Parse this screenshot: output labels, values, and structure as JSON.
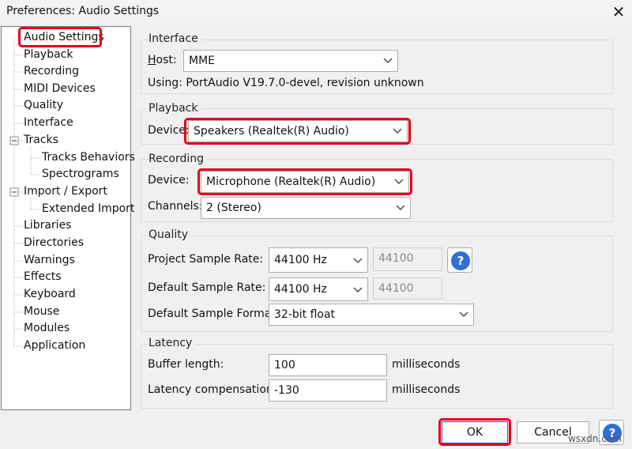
{
  "window": {
    "title": "Preferences: Audio Settings",
    "close_glyph": "✕"
  },
  "sidebar": {
    "items": [
      {
        "label": "Audio Settings"
      },
      {
        "label": "Playback"
      },
      {
        "label": "Recording"
      },
      {
        "label": "MIDI Devices"
      },
      {
        "label": "Quality"
      },
      {
        "label": "Interface"
      },
      {
        "label": "Tracks"
      },
      {
        "label": "Tracks Behaviors"
      },
      {
        "label": "Spectrograms"
      },
      {
        "label": "Import / Export"
      },
      {
        "label": "Extended Import"
      },
      {
        "label": "Libraries"
      },
      {
        "label": "Directories"
      },
      {
        "label": "Warnings"
      },
      {
        "label": "Effects"
      },
      {
        "label": "Keyboard"
      },
      {
        "label": "Mouse"
      },
      {
        "label": "Modules"
      },
      {
        "label": "Application"
      }
    ],
    "selected": "Audio Settings"
  },
  "interface": {
    "group_title": "Interface",
    "host_label_u": "H",
    "host_label_rest": "ost:",
    "host_value": "MME",
    "using_text": "Using: PortAudio V19.7.0-devel, revision unknown"
  },
  "playback": {
    "group_title": "Playback",
    "device_label_pre": "Device:",
    "device_value": "Speakers (Realtek(R) Audio)"
  },
  "recording": {
    "group_title": "Recording",
    "device_label": "Device:",
    "device_value": "Microphone (Realtek(R) Audio)",
    "channels_label": "Channels:",
    "channels_value": "2 (Stereo)"
  },
  "quality": {
    "group_title": "Quality",
    "project_rate_label": "Project Sample Rate:",
    "project_rate_value": "44100 Hz",
    "project_rate_custom": "44100",
    "default_rate_label": "Default Sample Rate:",
    "default_rate_value": "44100 Hz",
    "default_rate_custom": "44100",
    "default_format_label": "Default Sample Format:",
    "default_format_value": "32-bit float",
    "help_glyph": "?"
  },
  "latency": {
    "group_title": "Latency",
    "buffer_label": "Buffer length:",
    "buffer_value": "100",
    "buffer_unit": "milliseconds",
    "comp_label": "Latency compensation:",
    "comp_value": "-130",
    "comp_unit": "milliseconds"
  },
  "footer": {
    "ok_label": "OK",
    "cancel_label": "Cancel",
    "help_glyph": "?"
  },
  "watermark": "wsxdn.com",
  "colors": {
    "highlight": "#e0001b",
    "help": "#2f6fd6"
  }
}
